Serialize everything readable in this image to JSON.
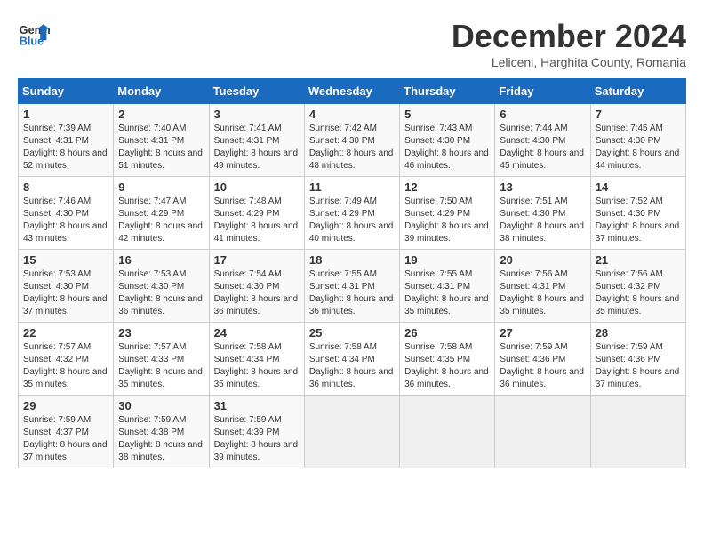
{
  "header": {
    "logo_line1": "General",
    "logo_line2": "Blue",
    "title": "December 2024",
    "subtitle": "Leliceni, Harghita County, Romania"
  },
  "columns": [
    "Sunday",
    "Monday",
    "Tuesday",
    "Wednesday",
    "Thursday",
    "Friday",
    "Saturday"
  ],
  "weeks": [
    [
      {
        "day": "1",
        "sunrise": "7:39 AM",
        "sunset": "4:31 PM",
        "daylight": "8 hours and 52 minutes."
      },
      {
        "day": "2",
        "sunrise": "7:40 AM",
        "sunset": "4:31 PM",
        "daylight": "8 hours and 51 minutes."
      },
      {
        "day": "3",
        "sunrise": "7:41 AM",
        "sunset": "4:31 PM",
        "daylight": "8 hours and 49 minutes."
      },
      {
        "day": "4",
        "sunrise": "7:42 AM",
        "sunset": "4:30 PM",
        "daylight": "8 hours and 48 minutes."
      },
      {
        "day": "5",
        "sunrise": "7:43 AM",
        "sunset": "4:30 PM",
        "daylight": "8 hours and 46 minutes."
      },
      {
        "day": "6",
        "sunrise": "7:44 AM",
        "sunset": "4:30 PM",
        "daylight": "8 hours and 45 minutes."
      },
      {
        "day": "7",
        "sunrise": "7:45 AM",
        "sunset": "4:30 PM",
        "daylight": "8 hours and 44 minutes."
      }
    ],
    [
      {
        "day": "8",
        "sunrise": "7:46 AM",
        "sunset": "4:30 PM",
        "daylight": "8 hours and 43 minutes."
      },
      {
        "day": "9",
        "sunrise": "7:47 AM",
        "sunset": "4:29 PM",
        "daylight": "8 hours and 42 minutes."
      },
      {
        "day": "10",
        "sunrise": "7:48 AM",
        "sunset": "4:29 PM",
        "daylight": "8 hours and 41 minutes."
      },
      {
        "day": "11",
        "sunrise": "7:49 AM",
        "sunset": "4:29 PM",
        "daylight": "8 hours and 40 minutes."
      },
      {
        "day": "12",
        "sunrise": "7:50 AM",
        "sunset": "4:29 PM",
        "daylight": "8 hours and 39 minutes."
      },
      {
        "day": "13",
        "sunrise": "7:51 AM",
        "sunset": "4:30 PM",
        "daylight": "8 hours and 38 minutes."
      },
      {
        "day": "14",
        "sunrise": "7:52 AM",
        "sunset": "4:30 PM",
        "daylight": "8 hours and 37 minutes."
      }
    ],
    [
      {
        "day": "15",
        "sunrise": "7:53 AM",
        "sunset": "4:30 PM",
        "daylight": "8 hours and 37 minutes."
      },
      {
        "day": "16",
        "sunrise": "7:53 AM",
        "sunset": "4:30 PM",
        "daylight": "8 hours and 36 minutes."
      },
      {
        "day": "17",
        "sunrise": "7:54 AM",
        "sunset": "4:30 PM",
        "daylight": "8 hours and 36 minutes."
      },
      {
        "day": "18",
        "sunrise": "7:55 AM",
        "sunset": "4:31 PM",
        "daylight": "8 hours and 36 minutes."
      },
      {
        "day": "19",
        "sunrise": "7:55 AM",
        "sunset": "4:31 PM",
        "daylight": "8 hours and 35 minutes."
      },
      {
        "day": "20",
        "sunrise": "7:56 AM",
        "sunset": "4:31 PM",
        "daylight": "8 hours and 35 minutes."
      },
      {
        "day": "21",
        "sunrise": "7:56 AM",
        "sunset": "4:32 PM",
        "daylight": "8 hours and 35 minutes."
      }
    ],
    [
      {
        "day": "22",
        "sunrise": "7:57 AM",
        "sunset": "4:32 PM",
        "daylight": "8 hours and 35 minutes."
      },
      {
        "day": "23",
        "sunrise": "7:57 AM",
        "sunset": "4:33 PM",
        "daylight": "8 hours and 35 minutes."
      },
      {
        "day": "24",
        "sunrise": "7:58 AM",
        "sunset": "4:34 PM",
        "daylight": "8 hours and 35 minutes."
      },
      {
        "day": "25",
        "sunrise": "7:58 AM",
        "sunset": "4:34 PM",
        "daylight": "8 hours and 36 minutes."
      },
      {
        "day": "26",
        "sunrise": "7:58 AM",
        "sunset": "4:35 PM",
        "daylight": "8 hours and 36 minutes."
      },
      {
        "day": "27",
        "sunrise": "7:59 AM",
        "sunset": "4:36 PM",
        "daylight": "8 hours and 36 minutes."
      },
      {
        "day": "28",
        "sunrise": "7:59 AM",
        "sunset": "4:36 PM",
        "daylight": "8 hours and 37 minutes."
      }
    ],
    [
      {
        "day": "29",
        "sunrise": "7:59 AM",
        "sunset": "4:37 PM",
        "daylight": "8 hours and 37 minutes."
      },
      {
        "day": "30",
        "sunrise": "7:59 AM",
        "sunset": "4:38 PM",
        "daylight": "8 hours and 38 minutes."
      },
      {
        "day": "31",
        "sunrise": "7:59 AM",
        "sunset": "4:39 PM",
        "daylight": "8 hours and 39 minutes."
      },
      null,
      null,
      null,
      null
    ]
  ]
}
